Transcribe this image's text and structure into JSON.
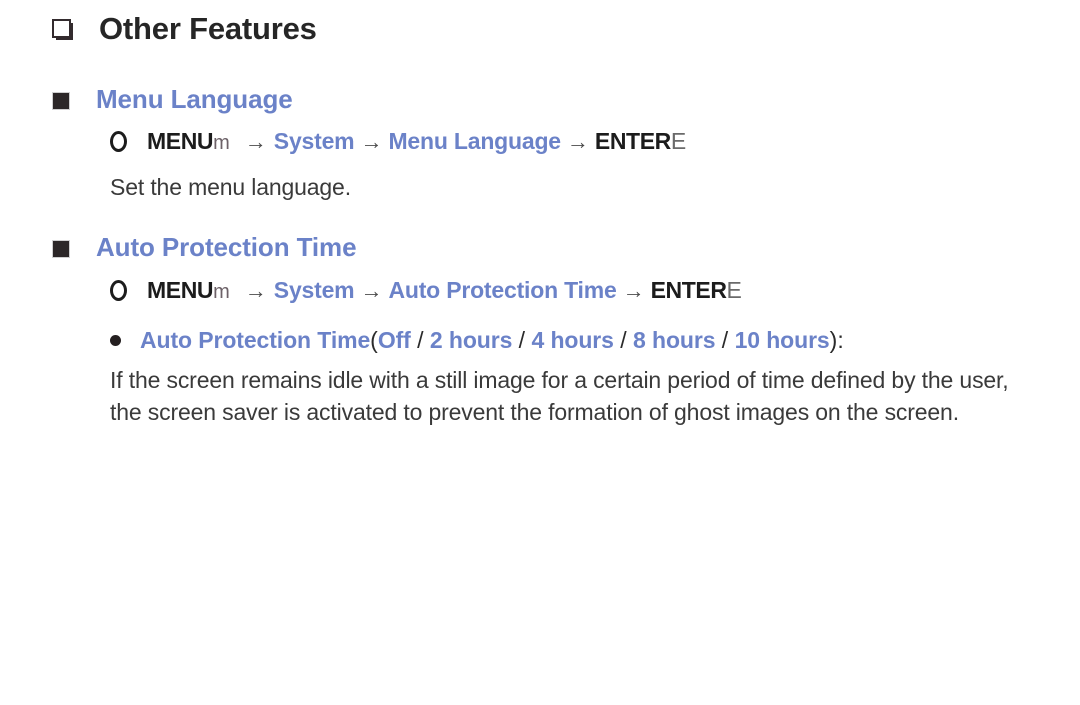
{
  "page": {
    "title": "Other Features",
    "title_bullet_icon": "hollow-square-icon"
  },
  "sections": [
    {
      "id": "menu-language",
      "bullet_icon": "filled-square-icon",
      "title": "Menu Language",
      "menu_path": {
        "prefix_icon": "circle-outline-icon",
        "key_label": "MENU",
        "key_symbol": "m",
        "arrow": "→",
        "steps": [
          "System",
          "Menu Language"
        ],
        "enter_label": "ENTER",
        "enter_symbol": "E"
      },
      "description": "Set the menu language."
    },
    {
      "id": "auto-protection-time",
      "bullet_icon": "filled-square-icon",
      "title": "Auto Protection Time",
      "menu_path": {
        "prefix_icon": "circle-outline-icon",
        "key_label": "MENU",
        "key_symbol": "m",
        "arrow": "→",
        "steps": [
          "System",
          "Auto Protection Time"
        ],
        "enter_label": "ENTER",
        "enter_symbol": "E"
      },
      "option_line": {
        "bullet_icon": "dot-icon",
        "label": "Auto Protection Time",
        "open_paren": "(",
        "options": [
          "Off",
          "2 hours",
          "4 hours",
          "8 hours",
          "10 hours"
        ],
        "separator": "/",
        "close_paren": ")",
        "colon": ":"
      },
      "body": "If the screen remains idle with a still image for a certain period of time defined by the user, the screen saver is activated to prevent the formation of ghost images on the screen."
    }
  ],
  "colors": {
    "accent_blue": "#6b82c8",
    "text_dark": "#2f2f2f",
    "bullet_dark": "#2b2627",
    "background": "#ffffff"
  }
}
